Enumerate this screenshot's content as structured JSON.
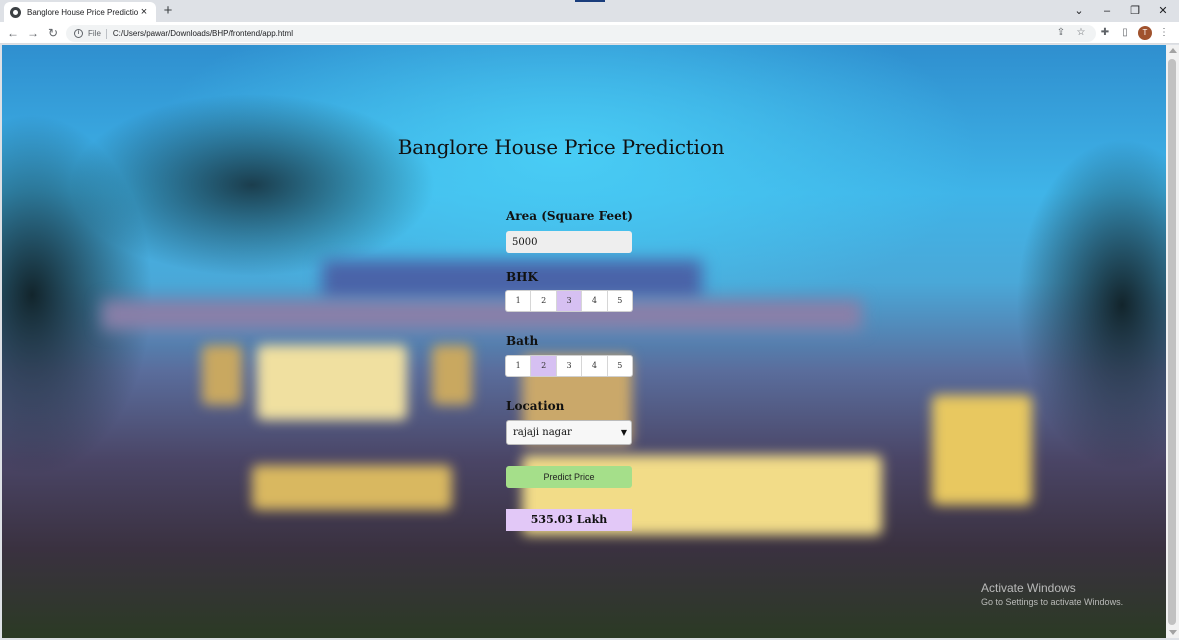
{
  "browser": {
    "tab_title": "Banglore House Price Prediction",
    "tab_close": "×",
    "new_tab": "+",
    "scheme_label": "File",
    "url": "C:/Users/pawar/Downloads/BHP/frontend/app.html",
    "profile_initial": "T",
    "window_controls": {
      "chevron": "⌄",
      "minimize": "–",
      "restore": "❐",
      "close": "✕"
    },
    "nav": {
      "back": "←",
      "forward": "→",
      "reload": "↻"
    },
    "toolbar_icons": {
      "share": "⇪",
      "star": "☆",
      "extensions": "✚",
      "sidepanel": "▯",
      "menu": "⋮"
    }
  },
  "page": {
    "title": "Banglore House Price Prediction",
    "area": {
      "label": "Area (Square Feet)",
      "value": "5000"
    },
    "bhk": {
      "label": "BHK",
      "options": [
        "1",
        "2",
        "3",
        "4",
        "5"
      ],
      "selected": "3"
    },
    "bath": {
      "label": "Bath",
      "options": [
        "1",
        "2",
        "3",
        "4",
        "5"
      ],
      "selected": "2"
    },
    "location": {
      "label": "Location",
      "selected": "rajaji nagar"
    },
    "predict_button": "Predict Price",
    "result": "535.03 Lakh"
  },
  "os_overlay": {
    "activate_title": "Activate Windows",
    "activate_sub": "Go to Settings to activate Windows."
  },
  "colors": {
    "selected_option": "#d6c0f2",
    "predict_button": "#a5df8a",
    "result_background": "#e2c8f7"
  }
}
